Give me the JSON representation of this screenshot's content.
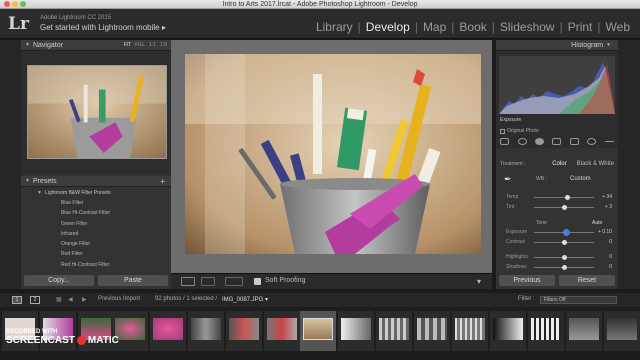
{
  "window": {
    "title": "Intro to Arts 2017.lrcat - Adobe Photoshop Lightroom - Develop"
  },
  "identity": {
    "logo": "Lr",
    "app_name": "Adobe Lightroom CC 2015",
    "tagline": "Get started with Lightroom mobile ▸"
  },
  "modules": [
    "Library",
    "Develop",
    "Map",
    "Book",
    "Slideshow",
    "Print",
    "Web"
  ],
  "active_module": "Develop",
  "navigator": {
    "title": "Navigator",
    "zoom_options": [
      "FIT",
      "FILL",
      "1:1",
      "1:8"
    ]
  },
  "presets": {
    "title": "Presets",
    "add_symbol": "+",
    "folder": "Lightroom B&W Filter Presets",
    "items": [
      "Blue Filter",
      "Blue Hi-Contrast Filter",
      "Green Filter",
      "Infrared",
      "Orange Filter",
      "Red Filter",
      "Red Hi-Contrast Filter"
    ]
  },
  "left_buttons": {
    "copy": "Copy...",
    "paste": "Paste"
  },
  "toolbar": {
    "soft_proofing": "Soft Proofing"
  },
  "histogram": {
    "title": "Histogram",
    "exposure_label": "Exposure",
    "original_photo": "Original Photo"
  },
  "basic": {
    "treatment_label": "Treatment :",
    "treatment_options": [
      "Color",
      "Black & White"
    ],
    "wb_label": "WB :",
    "wb_value": "Custom",
    "tone_label": "Tone",
    "auto_label": "Auto",
    "sliders": [
      {
        "label": "Temp",
        "value": "+ 34",
        "pos": 0.55
      },
      {
        "label": "Tint",
        "value": "+ 3",
        "pos": 0.51
      },
      {
        "label": "Exposure",
        "value": "+ 0.10",
        "pos": 0.52
      },
      {
        "label": "Contrast",
        "value": "0",
        "pos": 0.5
      },
      {
        "label": "Highlights",
        "value": "0",
        "pos": 0.5
      },
      {
        "label": "Shadows",
        "value": "0",
        "pos": 0.5
      }
    ]
  },
  "right_buttons": {
    "previous": "Previous",
    "reset": "Reset"
  },
  "filmbar": {
    "monitors": [
      "1",
      "2"
    ],
    "source": "Previous Import",
    "count": "92 photos / 1 selected /",
    "filename": "IMG_0087.JPG ▾",
    "filter_label": "Filter :",
    "filter_value": "Filters Off"
  },
  "watermark": {
    "line1": "RECORDED WITH",
    "brand": "SCREENCAST",
    "brand_suffix": "MATIC"
  },
  "colors": {
    "panel": "#333333",
    "accent_purple": "#b43c9e",
    "pencil_yellow": "#e8b21e"
  }
}
